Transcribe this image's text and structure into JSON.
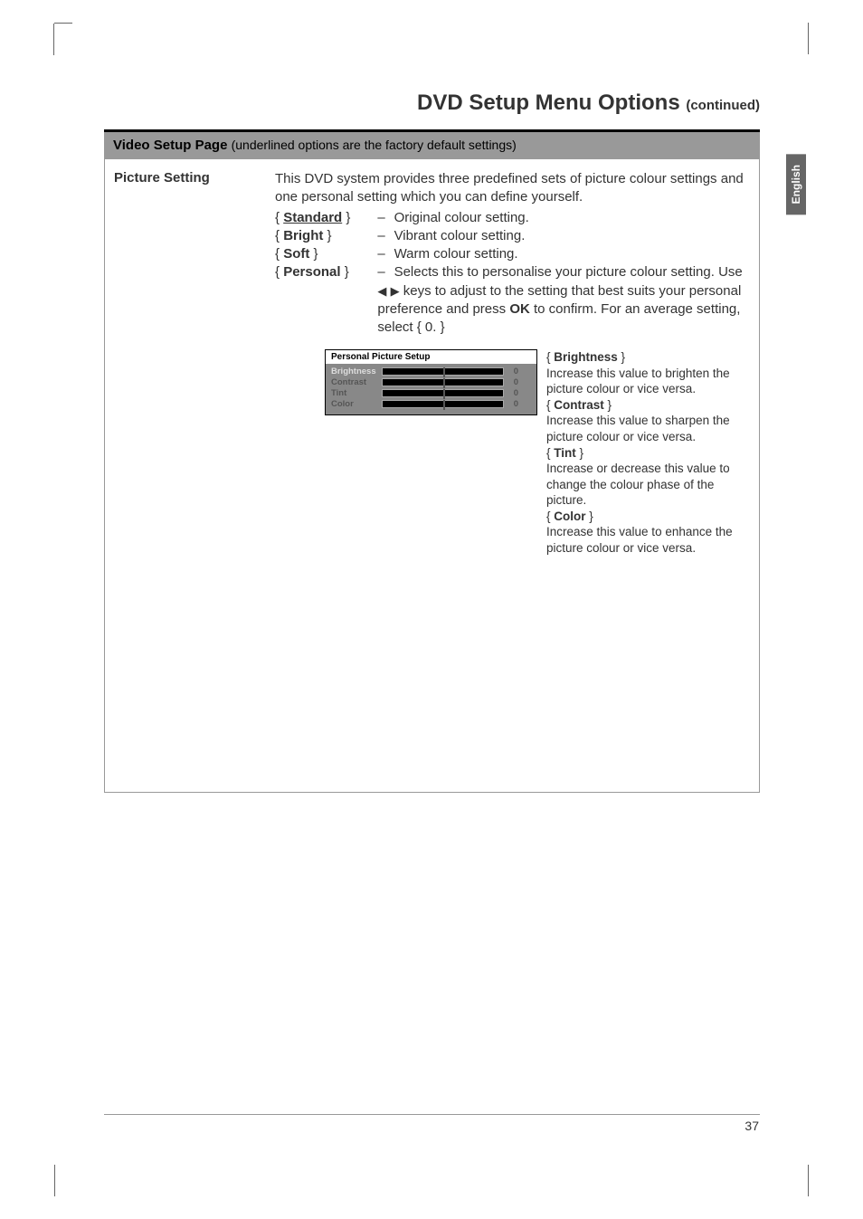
{
  "page": {
    "title": "DVD Setup Menu Options",
    "continued": "(continued)",
    "language_tab": "English",
    "page_number": "37"
  },
  "section": {
    "header_title": "Video Setup Page",
    "header_subtitle": "(underlined options are the factory default settings)"
  },
  "setting": {
    "label": "Picture Setting",
    "intro": "This DVD system provides three predefined sets of picture colour settings and one personal setting which you can define yourself.",
    "options": {
      "standard": {
        "name": "Standard",
        "desc": "Original colour setting."
      },
      "bright": {
        "name": "Bright",
        "desc": "Vibrant colour setting."
      },
      "soft": {
        "name": "Soft",
        "desc": "Warm colour setting."
      },
      "personal": {
        "name": "Personal",
        "desc_prefix": "Selects this to personalise your picture colour setting.  Use ",
        "desc_mid": " keys to adjust to the setting that best suits your personal preference and press ",
        "ok": "OK",
        "desc_suffix": " to confirm.  For an average setting, select { 0. }"
      }
    }
  },
  "picture_setup": {
    "title": "Personal Picture Setup",
    "rows": [
      {
        "label": "Brightness",
        "value": "0",
        "highlighted": true
      },
      {
        "label": "Contrast",
        "value": "0",
        "highlighted": false
      },
      {
        "label": "Tint",
        "value": "0",
        "highlighted": false
      },
      {
        "label": "Color",
        "value": "0",
        "highlighted": false
      }
    ]
  },
  "params": {
    "brightness": {
      "name": "Brightness",
      "desc": "Increase this value to brighten the picture colour or vice versa."
    },
    "contrast": {
      "name": "Contrast",
      "desc": "Increase this value to sharpen the picture colour or vice versa."
    },
    "tint": {
      "name": "Tint",
      "desc": "Increase or decrease this value to change the colour phase of the picture."
    },
    "color": {
      "name": "Color",
      "desc": "Increase this value to enhance the picture colour or vice versa."
    }
  }
}
